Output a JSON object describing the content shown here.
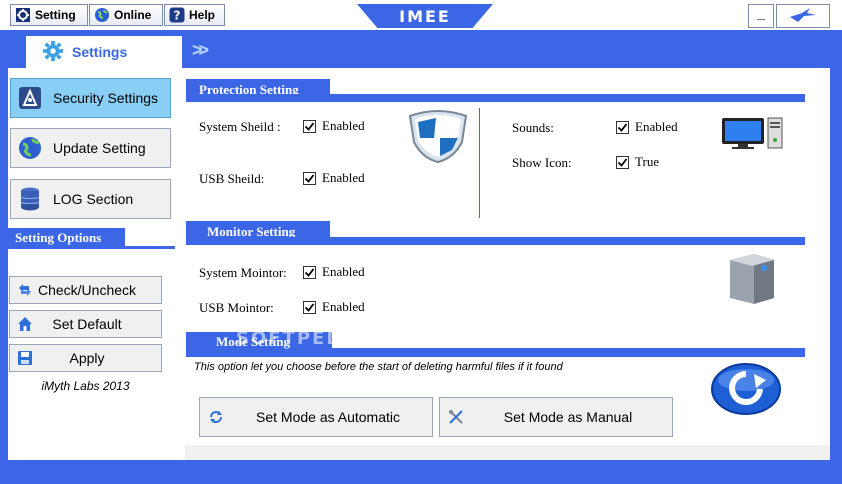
{
  "toolbar": {
    "setting_label": "Setting",
    "online_label": "Online",
    "help_label": "Help",
    "help_icon_glyph": "?",
    "logo_text": "IMEE",
    "minimize_glyph": "_"
  },
  "header": {
    "tab_label": "Settings",
    "chevrons": ">>"
  },
  "sidebar": {
    "items": [
      {
        "label": "Security Settings",
        "active": true
      },
      {
        "label": "Update Setting",
        "active": false
      },
      {
        "label": "LOG Section",
        "active": false
      }
    ],
    "options_title": "Setting Options",
    "options": [
      {
        "label": "Check/Uncheck"
      },
      {
        "label": "Set Default"
      },
      {
        "label": "Apply"
      }
    ],
    "credit": "iMyth Labs 2013"
  },
  "protection": {
    "title": "Protection Setting",
    "rows": [
      {
        "label": "System Sheild :",
        "value": "Enabled",
        "checked": true
      },
      {
        "label": "USB Sheild:",
        "value": "Enabled",
        "checked": true
      }
    ],
    "right_rows": [
      {
        "label": "Sounds:",
        "value": "Enabled",
        "checked": true
      },
      {
        "label": "Show Icon:",
        "value": "True",
        "checked": true
      }
    ]
  },
  "monitor": {
    "title": "Monitor Setting",
    "rows": [
      {
        "label": "System Mointor:",
        "value": "Enabled",
        "checked": true
      },
      {
        "label": "USB Mointor:",
        "value": "Enabled",
        "checked": true
      }
    ]
  },
  "mode": {
    "title": "Mode Setting",
    "description": "This option let you choose before the start of deleting harmful files if it found",
    "auto_label": "Set Mode as Automatic",
    "manual_label": "Set  Mode as Manual"
  },
  "watermark": "SOFTPEDIA",
  "colors": {
    "frame_blue": "#3b67e6",
    "active_item": "#89cff5",
    "button_bg": "#f0f0f0"
  }
}
